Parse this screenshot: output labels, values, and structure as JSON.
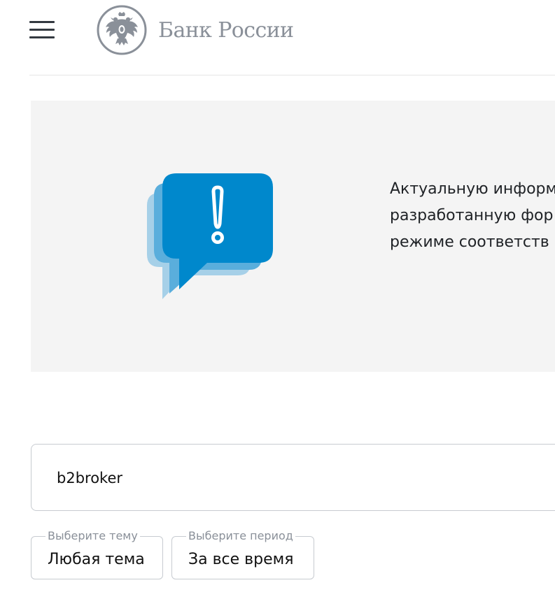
{
  "header": {
    "logo_text": "Банк России",
    "menu_icon": "hamburger-menu-icon",
    "emblem_icon": "double-headed-eagle-emblem-icon"
  },
  "notice": {
    "icon": "exclamation-speech-bubble-icon",
    "lines": [
      "Актуальную информ",
      "разработанную фор",
      "режиме соответств"
    ]
  },
  "search": {
    "value": "b2broker"
  },
  "filters": {
    "topic": {
      "label": "Выберите тему",
      "value": "Любая тема"
    },
    "period": {
      "label": "Выберите период",
      "value": "За все время"
    }
  },
  "colors": {
    "brand_gray": "#8a9099",
    "notice_bg": "#f4f4f4",
    "bubble_blue": "#0088cc",
    "bubble_mid": "#5aaedc",
    "bubble_light": "#a6d0e8"
  }
}
